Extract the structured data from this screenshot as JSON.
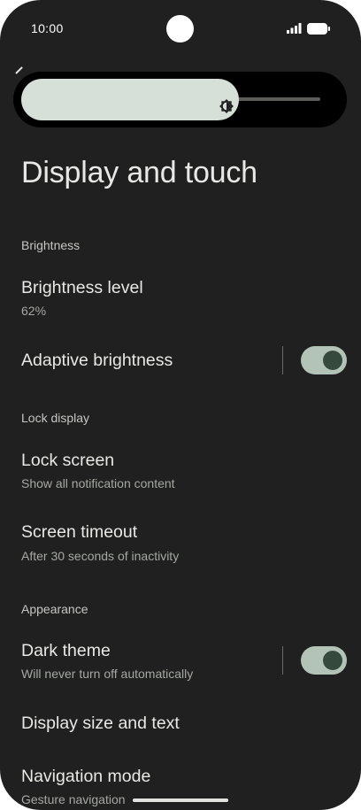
{
  "status_bar": {
    "time": "10:00",
    "icons": [
      "signal-icon",
      "battery-icon"
    ]
  },
  "brightness_slider": {
    "level_percent": 62,
    "icon": "brightness-icon"
  },
  "page": {
    "title": "Display and touch"
  },
  "sections": {
    "brightness": {
      "header": "Brightness",
      "level": {
        "title": "Brightness level",
        "value": "62%"
      },
      "adaptive": {
        "title": "Adaptive brightness",
        "enabled": true
      }
    },
    "lock_display": {
      "header": "Lock display",
      "lock_screen": {
        "title": "Lock screen",
        "summary": "Show all notification content"
      },
      "screen_timeout": {
        "title": "Screen timeout",
        "summary": "After 30 seconds of inactivity"
      }
    },
    "appearance": {
      "header": "Appearance",
      "dark_theme": {
        "title": "Dark theme",
        "summary": "Will never turn off automatically",
        "enabled": true
      },
      "display_size": {
        "title": "Display size and text"
      },
      "navigation": {
        "title": "Navigation mode",
        "summary": "Gesture navigation"
      }
    }
  },
  "colors": {
    "background": "#1f201f",
    "toggle_track": "#b4c3b7",
    "toggle_thumb": "#354a3d",
    "slider_fill": "#d6dfd8"
  }
}
